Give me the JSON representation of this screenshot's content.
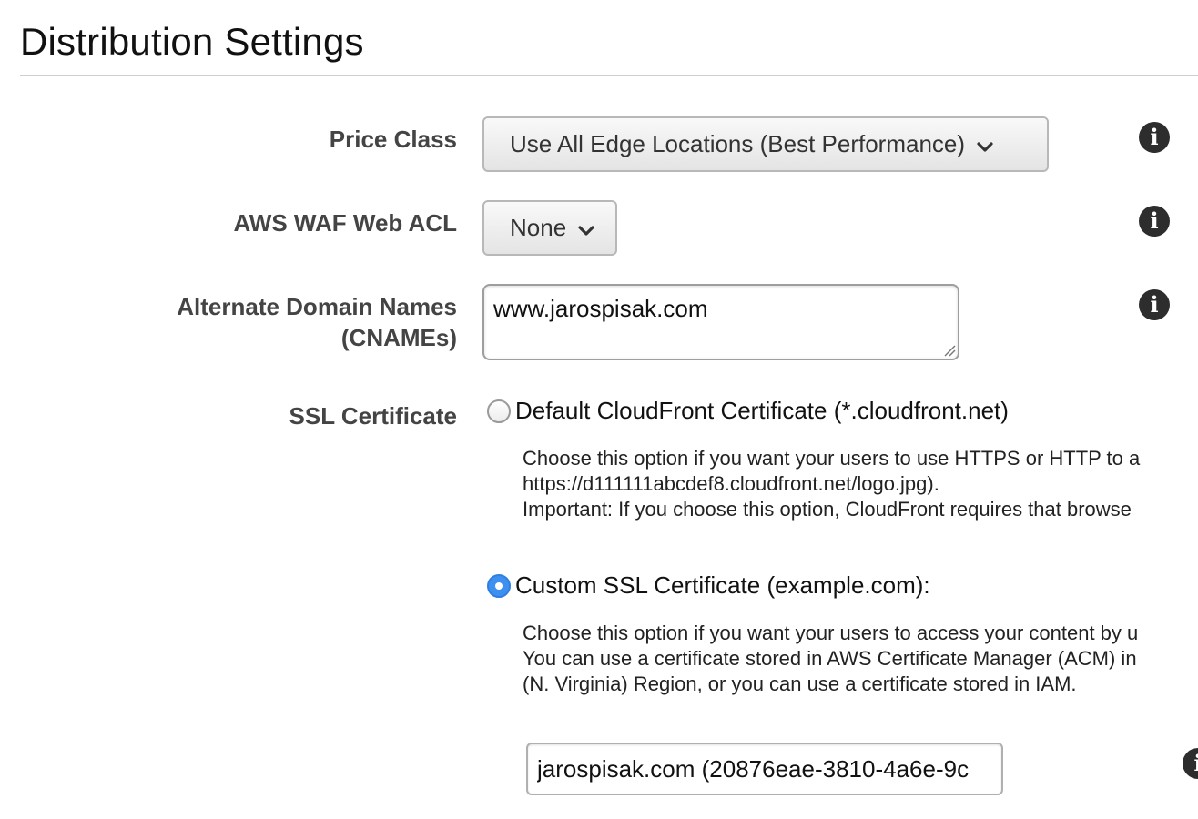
{
  "section": {
    "title": "Distribution Settings"
  },
  "price_class": {
    "label": "Price Class",
    "selected": "Use All Edge Locations (Best Performance)",
    "info_icon": "info-icon"
  },
  "waf": {
    "label": "AWS WAF Web ACL",
    "selected": "None",
    "info_icon": "info-icon"
  },
  "cnames": {
    "label_line1": "Alternate Domain Names",
    "label_line2": "(CNAMEs)",
    "value": "www.jarospisak.com",
    "info_icon": "info-icon"
  },
  "ssl": {
    "label": "SSL Certificate",
    "default_option": {
      "label": "Default CloudFront Certificate (*.cloudfront.net)",
      "selected": false,
      "desc_line1": "Choose this option if you want your users to use HTTPS or HTTP to a",
      "desc_line2": "https://d111111abcdef8.cloudfront.net/logo.jpg).",
      "desc_line3": "Important: If you choose this option, CloudFront requires that browse"
    },
    "custom_option": {
      "label": "Custom SSL Certificate (example.com):",
      "selected": true,
      "desc_line1": "Choose this option if you want your users to access your content by u",
      "desc_line2": "You can use a certificate stored in AWS Certificate Manager (ACM) in",
      "desc_line3": "(N. Virginia) Region, or you can use a certificate stored in IAM."
    },
    "certificate_value": "jarospisak.com (20876eae-3810-4a6e-9c"
  },
  "colors": {
    "radio_selected": "#3d8ff0",
    "info_icon": "#2d2d2d",
    "label_text": "#444444"
  }
}
